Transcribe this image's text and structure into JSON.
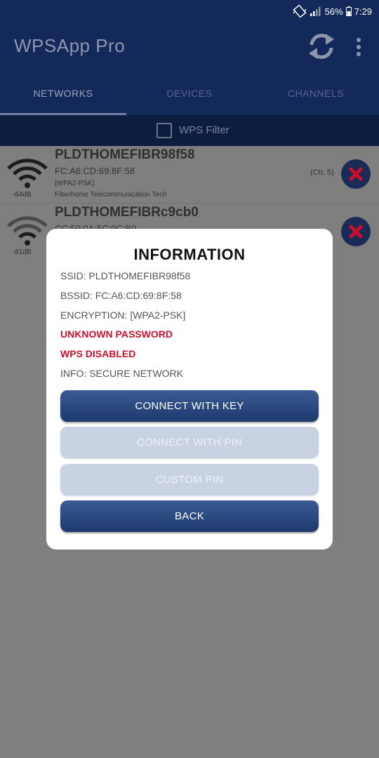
{
  "status_bar": {
    "battery": "56%",
    "time": "7:29"
  },
  "app_bar": {
    "title": "WPSApp Pro"
  },
  "tabs": [
    {
      "label": "NETWORKS",
      "active": true
    },
    {
      "label": "DEVICES",
      "active": false
    },
    {
      "label": "CHANNELS",
      "active": false
    }
  ],
  "filter": {
    "label": "WPS Filter",
    "checked": false
  },
  "networks": [
    {
      "ssid": "PLDTHOMEFIBR98f58",
      "bssid": "FC:A6:CD:69:8F:58",
      "encryption": "[WPA2-PSK]",
      "vendor": "Fiberhome Telecommunication Tech",
      "signal": "-64dB",
      "channel": "(Ch: 5)"
    },
    {
      "ssid": "PLDTHOMEFIBRc9cb0",
      "bssid": "CC:50:0A:5C:9C:B0",
      "encryption": "",
      "vendor": "",
      "signal": "-81dB",
      "channel": ""
    }
  ],
  "dialog": {
    "title": "INFORMATION",
    "ssid_line": "SSID: PLDTHOMEFIBR98f58",
    "bssid_line": "BSSID: FC:A6:CD:69:8F:58",
    "encryption_line": "ENCRYPTION: [WPA2-PSK]",
    "password_status": "UNKNOWN PASSWORD",
    "wps_status": "WPS DISABLED",
    "info_line": "INFO: SECURE NETWORK",
    "buttons": {
      "connect_key": "CONNECT WITH KEY",
      "connect_pin": "CONNECT WITH PIN",
      "custom_pin": "CUSTOM PIN",
      "back": "BACK"
    }
  },
  "colors": {
    "app_bar": "#12295a",
    "accent_red": "#c8102e",
    "button_primary": "#2a4a80",
    "button_disabled": "#c8d2e3"
  }
}
